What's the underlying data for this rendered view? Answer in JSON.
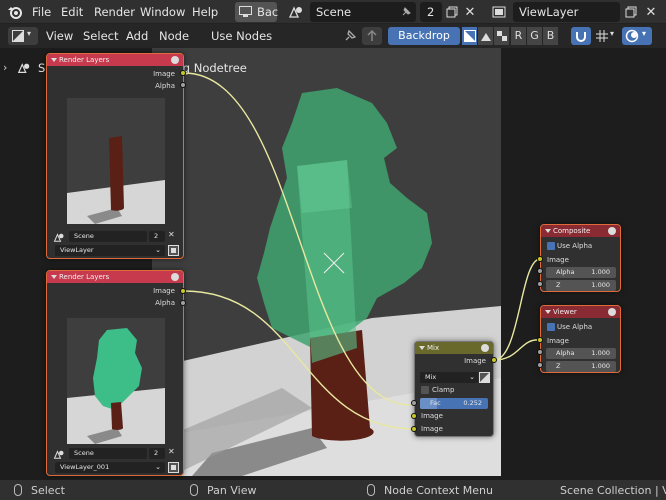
{
  "menubar": {
    "items": [
      "File",
      "Edit",
      "Render",
      "Window",
      "Help"
    ],
    "workspace_label": "Bac",
    "scene_field": "Scene",
    "scene_users": "2",
    "viewlayer_field": "ViewLayer"
  },
  "header": {
    "view": "View",
    "select": "Select",
    "add": "Add",
    "node": "Node",
    "use_nodes": "Use Nodes",
    "backdrop": "Backdrop",
    "channels": [
      "R",
      "G",
      "B"
    ]
  },
  "breadcrumb": {
    "scene": "Scene",
    "tree": "Compositing Nodetree"
  },
  "nodes": {
    "render_layers_1": {
      "title": "Render Layers",
      "output_image": "Image",
      "output_alpha": "Alpha",
      "scene": "Scene",
      "scene_users": "2",
      "layer": "ViewLayer"
    },
    "render_layers_2": {
      "title": "Render Layers",
      "output_image": "Image",
      "output_alpha": "Alpha",
      "scene": "Scene",
      "scene_users": "2",
      "layer": "ViewLayer_001"
    },
    "mix": {
      "title": "Mix",
      "output_image": "Image",
      "mode": "Mix",
      "clamp": "Clamp",
      "fac_label": "Fac",
      "fac_value": "0.252",
      "input_image_1": "Image",
      "input_image_2": "Image"
    },
    "composite": {
      "title": "Composite",
      "use_alpha": "Use Alpha",
      "image": "Image",
      "alpha_label": "Alpha",
      "alpha_value": "1.000",
      "z_label": "Z",
      "z_value": "1.000"
    },
    "viewer": {
      "title": "Viewer",
      "use_alpha": "Use Alpha",
      "image": "Image",
      "alpha_label": "Alpha",
      "alpha_value": "1.000",
      "z_label": "Z",
      "z_value": "1.000"
    }
  },
  "statusbar": {
    "select": "Select",
    "pan": "Pan View",
    "context": "Node Context Menu",
    "info": "Scene Collection | Vert"
  },
  "colors": {
    "render_layer_header": "#c73a4e",
    "output_header": "#8a2b33",
    "mix_header": "#69692b",
    "accent": "#4772b3",
    "socket_yellow": "#c7c729",
    "tree_green": "#3fa56f",
    "trunk": "#5a2015"
  }
}
